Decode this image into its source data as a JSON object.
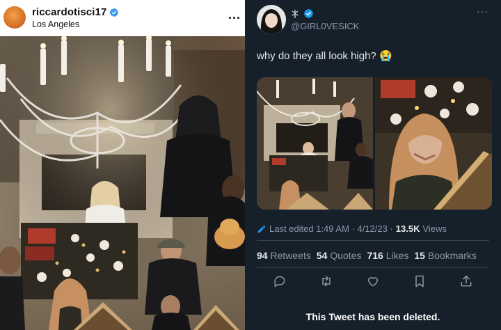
{
  "instagram": {
    "username": "riccardotisci17",
    "location": "Los Angeles",
    "more_label": "...",
    "verified": true,
    "icons": {
      "verified": "verified-badge-icon",
      "more": "more-dots-icon"
    }
  },
  "tweet": {
    "handle": "@GIRL0VESICK",
    "more_label": "···",
    "text": "why do they all look high? 😭",
    "edited_label": "Last edited 1:49 AM · 4/12/23 ·",
    "views_count": "13.5K",
    "views_label": "Views",
    "stats": [
      {
        "count": "94",
        "label": "Retweets"
      },
      {
        "count": "54",
        "label": "Quotes"
      },
      {
        "count": "716",
        "label": "Likes"
      },
      {
        "count": "15",
        "label": "Bookmarks"
      }
    ],
    "actions": [
      "reply-icon",
      "retweet-icon",
      "like-icon",
      "bookmark-icon",
      "share-icon"
    ],
    "deleted_notice": "This Tweet has been deleted.",
    "colors": {
      "background": "#15202b",
      "text": "#e7e9ea",
      "muted": "#8b98a5",
      "accent": "#1d9bf0",
      "divider": "#38444d"
    }
  }
}
